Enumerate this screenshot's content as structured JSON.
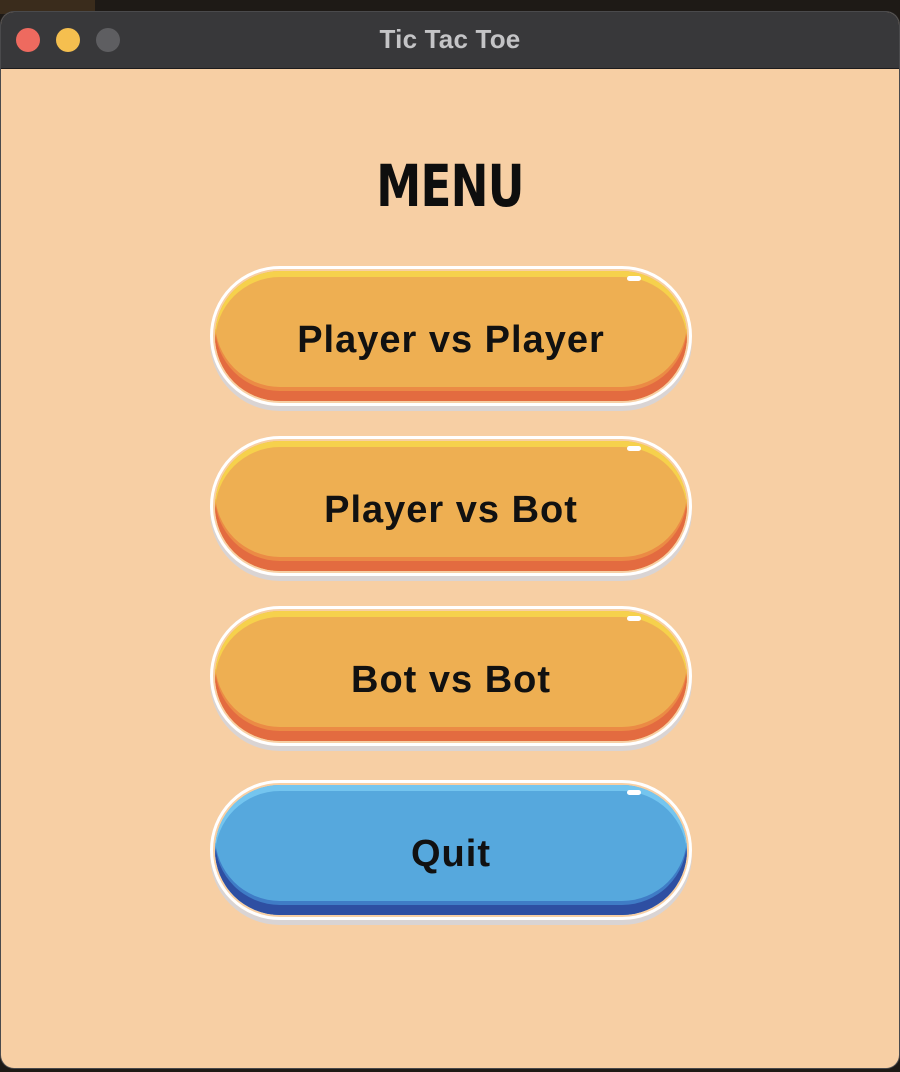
{
  "window": {
    "title": "Tic Tac Toe"
  },
  "menu": {
    "title": "MENU",
    "buttons": [
      {
        "label": "Player vs Player",
        "color": "#eeaf52"
      },
      {
        "label": "Player vs Bot",
        "color": "#eeaf52"
      },
      {
        "label": "Bot vs Bot",
        "color": "#eeaf52"
      },
      {
        "label": "Quit",
        "color": "#56a8dd"
      }
    ]
  },
  "colors": {
    "background": "#f7cfa4",
    "titlebar": "#38383a",
    "close": "#ee6a5f",
    "minimize": "#f5bf4f",
    "zoom": "#5e5e61"
  }
}
